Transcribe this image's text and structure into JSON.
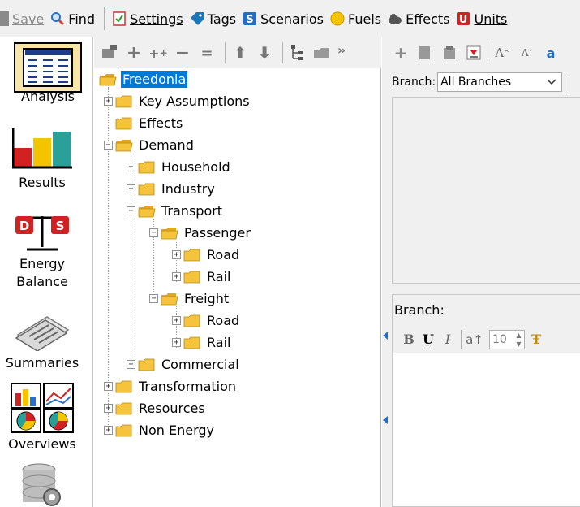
{
  "toolbar": {
    "save": "Save",
    "find": "Find",
    "settings": "Settings",
    "tags": "Tags",
    "scenarios": "Scenarios",
    "fuels": "Fuels",
    "effects": "Effects",
    "units": "Units"
  },
  "leftnav": {
    "analysis": "Analysis",
    "results": "Results",
    "energy_balance_line1": "Energy",
    "energy_balance_line2": "Balance",
    "summaries": "Summaries",
    "overviews": "Overviews"
  },
  "tree": {
    "root": "Freedonia",
    "key_assumptions": "Key Assumptions",
    "effects": "Effects",
    "demand": "Demand",
    "household": "Household",
    "industry": "Industry",
    "transport": "Transport",
    "passenger": "Passenger",
    "passenger_road": "Road",
    "passenger_rail": "Rail",
    "freight": "Freight",
    "freight_road": "Road",
    "freight_rail": "Rail",
    "commercial": "Commercial",
    "transformation": "Transformation",
    "resources": "Resources",
    "non_energy": "Non Energy"
  },
  "right": {
    "branch_label": "Branch:",
    "branch_value": "All Branches",
    "lower_branch_label": "Branch:",
    "font_size": "10"
  },
  "colors": {
    "selection": "#0078d7",
    "folder": "#f5c43c",
    "toolbar_bg": "#f0f0f0"
  }
}
